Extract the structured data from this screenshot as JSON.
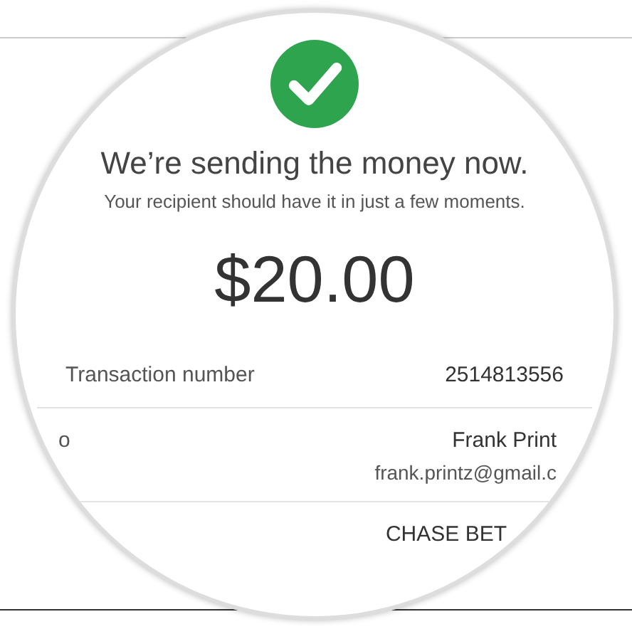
{
  "confirmation": {
    "heading": "We’re sending the money now.",
    "message": "Your recipient should have it in just a few moments.",
    "amount": "$20.00"
  },
  "details": [
    {
      "label": "Transaction number",
      "values": [
        "2514813556"
      ]
    },
    {
      "label": "o",
      "values": [
        "Frank Print",
        "frank.printz@gmail.c"
      ]
    },
    {
      "values": [
        "CHASE BET"
      ]
    }
  ]
}
